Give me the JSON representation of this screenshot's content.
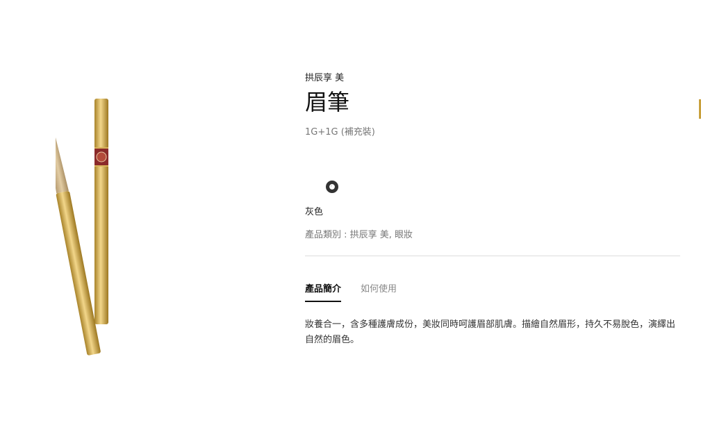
{
  "product": {
    "brand": "拱辰享 美",
    "name": "眉筆",
    "size": "1G+1G (補充裝)",
    "swatches": [
      {
        "color": "#333333",
        "selected": true
      }
    ],
    "color_name": "灰色",
    "category": "產品類別 : 拱辰享 美,  眼妝"
  },
  "tabs": [
    {
      "label": "產品簡介",
      "active": true
    },
    {
      "label": "如何使用",
      "active": false
    }
  ],
  "description": "妝養合一，含多種護膚成份，美妝同時呵護眉部肌膚。描繪自然眉形，持久不易脫色，演繹出自然的眉色。",
  "colors": {
    "gold": "#c8a03c",
    "accent": "#111111"
  }
}
